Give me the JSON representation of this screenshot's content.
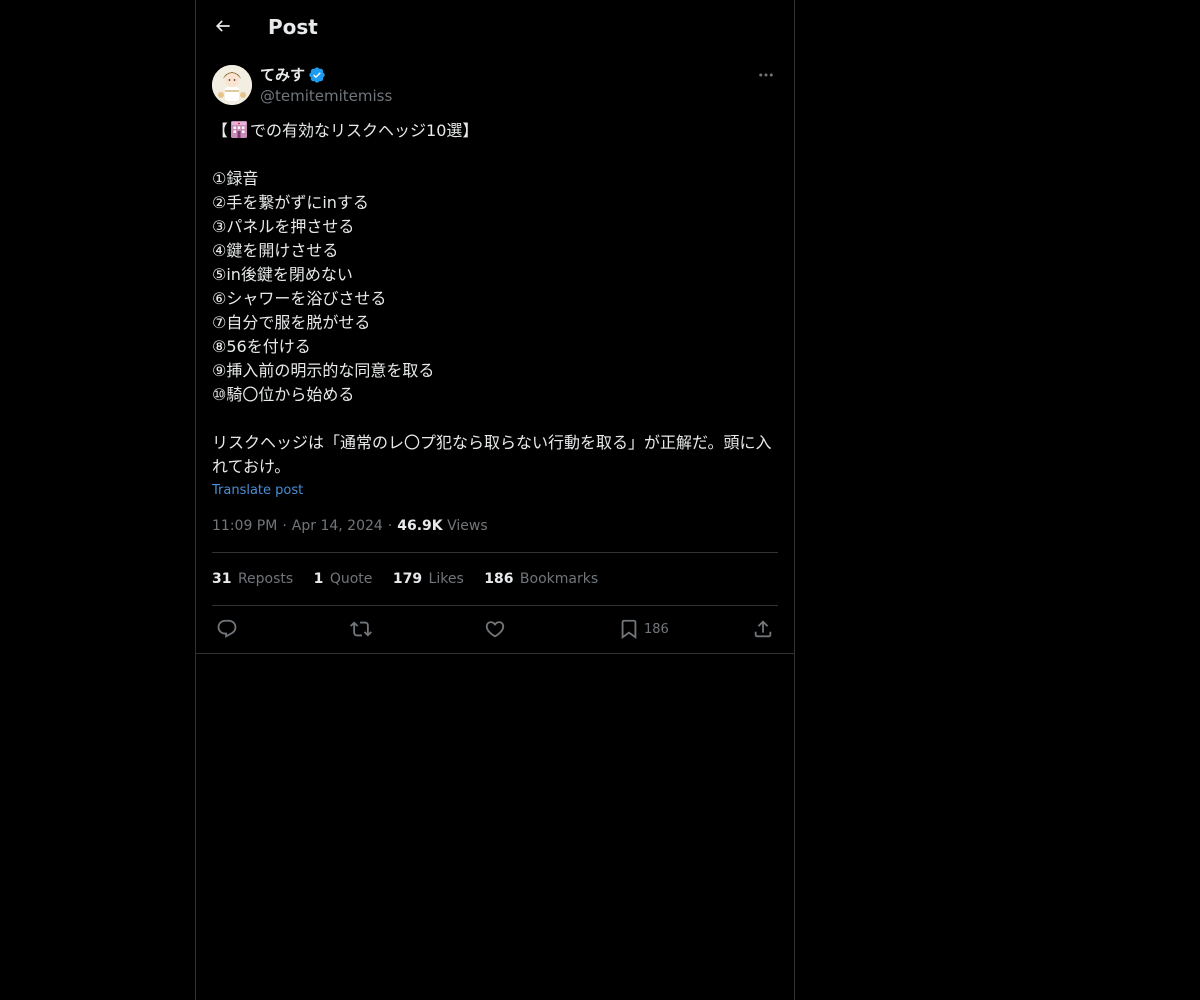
{
  "header": {
    "title": "Post",
    "back_icon": "arrow-left-icon"
  },
  "author": {
    "display_name": "てみす",
    "handle": "@temitemitemiss",
    "verified": true,
    "verified_color": "#1d9bf0"
  },
  "tweet": {
    "title_prefix": "【",
    "title_emoji": "hotel-emoji",
    "title_suffix": "での有効なリスクヘッジ10選】",
    "items": [
      "①録音",
      "②手を繋がずにinする",
      "③パネルを押させる",
      "④鍵を開けさせる",
      "⑤in後鍵を閉めない",
      "⑥シャワーを浴びさせる",
      "⑦自分で服を脱がせる",
      "⑧56を付ける",
      "⑨挿入前の明示的な同意を取る",
      "⑩騎〇位から始める"
    ],
    "conclusion": "リスクヘッジは「通常のレ〇プ犯なら取らない行動を取る」が正解だ。頭に入れておけ。",
    "translate_label": "Translate post"
  },
  "meta": {
    "time": "11:09 PM",
    "separator": "·",
    "date": "Apr 14, 2024",
    "views_count": "46.9K",
    "views_label": "Views"
  },
  "stats": {
    "reposts_count": "31",
    "reposts_label": "Reposts",
    "quotes_count": "1",
    "quotes_label": "Quote",
    "likes_count": "179",
    "likes_label": "Likes",
    "bookmarks_count": "186",
    "bookmarks_label": "Bookmarks"
  },
  "actions": {
    "reply_icon": "reply-icon",
    "repost_icon": "repost-icon",
    "like_icon": "heart-icon",
    "bookmark_icon": "bookmark-icon",
    "bookmark_count": "186",
    "share_icon": "share-icon"
  },
  "colors": {
    "background": "#000000",
    "text": "#e7e9ea",
    "secondary_text": "#71767b",
    "link": "#4a8ed6",
    "border": "#2f3336"
  }
}
